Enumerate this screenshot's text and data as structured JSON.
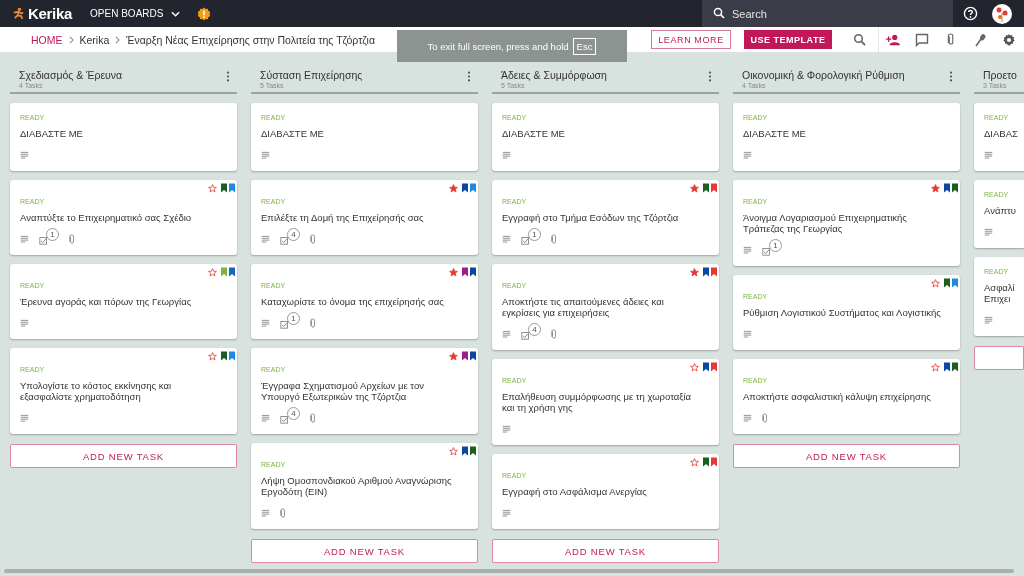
{
  "topbar": {
    "logo": "Kerika",
    "open_boards": "OPEN BOARDS",
    "search": {
      "placeholder": "Search"
    }
  },
  "breadcrumb": [
    "HOME",
    "Kerika",
    "Έναρξη Νέας Επιχείρησης στην Πολιτεία της Τζόρτζια"
  ],
  "buttons": {
    "learn_more": "LEARN MORE",
    "use_template": "USE TEMPLATE"
  },
  "fullscreen_notice": {
    "text": "To exit full screen, press and hold",
    "key": "Esc"
  },
  "columns": [
    {
      "title": "Σχεδιασμός & Έρευνα",
      "count": "4 Tasks",
      "add_label": "ADD NEW TASK",
      "cards": [
        {
          "status": "READY",
          "title": "ΔΙΑΒΑΣΤΕ ΜΕ"
        },
        {
          "status": "READY",
          "title": "Αναπτύξτε το Επιχειρηματικό σας Σχέδιο",
          "starred": false,
          "tags": [
            {
              "color": "#1b5e20"
            },
            {
              "color": "#1e88e5"
            }
          ],
          "checklist_count": "1",
          "attachment": true
        },
        {
          "status": "READY",
          "title": "Έρευνα αγοράς και πόρων της Γεωργίας",
          "starred": false,
          "tags": [
            {
              "color": "#7cb342"
            },
            {
              "color": "#1565c0"
            }
          ]
        },
        {
          "status": "READY",
          "title": "Υπολογίστε το κόστος εκκίνησης και εξασφαλίστε χρηματοδότηση",
          "starred": false,
          "tags": [
            {
              "color": "#1b5e20"
            },
            {
              "color": "#1e88e5"
            }
          ]
        }
      ]
    },
    {
      "title": "Σύσταση Επιχείρησης",
      "count": "5 Tasks",
      "add_label": "ADD NEW TASK",
      "cards": [
        {
          "status": "READY",
          "title": "ΔΙΑΒΑΣΤΕ ΜΕ"
        },
        {
          "status": "READY",
          "title": "Επιλέξτε τη Δομή της Επιχείρησής σας",
          "starred": true,
          "tags": [
            {
              "color": "#0d47a1"
            },
            {
              "color": "#1e88e5"
            }
          ],
          "checklist_count": "4",
          "attachment": true
        },
        {
          "status": "READY",
          "title": "Καταχωρίστε το όνομα της επιχείρησής σας",
          "starred": true,
          "tags": [
            {
              "color": "#9c1f8c"
            },
            {
              "color": "#0d47a1"
            }
          ],
          "checklist_count": "1",
          "attachment": true
        },
        {
          "status": "READY",
          "title": "Έγγραφα Σχηματισμού Αρχείων με τον Υπουργό Εξωτερικών της Τζόρτζια",
          "starred": true,
          "tags": [
            {
              "color": "#9c1f8c"
            },
            {
              "color": "#0d47a1"
            }
          ],
          "checklist_count": "4",
          "attachment": true
        },
        {
          "status": "READY",
          "title": "Λήψη Ομοσπονδιακού Αριθμού Αναγνώρισης Εργοδότη (EIN)",
          "starred": false,
          "tags": [
            {
              "color": "#0d47a1"
            },
            {
              "color": "#1b5e20"
            }
          ],
          "attachment": true
        }
      ]
    },
    {
      "title": "Άδειες & Συμμόρφωση",
      "count": "5 Tasks",
      "add_label": "ADD NEW TASK",
      "cards": [
        {
          "status": "READY",
          "title": "ΔΙΑΒΑΣΤΕ ΜΕ"
        },
        {
          "status": "READY",
          "title": "Εγγραφή στο Τμήμα Εσόδων της Τζόρτζια",
          "starred": true,
          "tags": [
            {
              "color": "#1b5e20"
            },
            {
              "color": "#e53935"
            }
          ],
          "checklist_count": "1",
          "attachment": true
        },
        {
          "status": "READY",
          "title": "Αποκτήστε τις απαιτούμενες άδειες και εγκρίσεις για επιχειρήσεις",
          "starred": true,
          "tags": [
            {
              "color": "#0d47a1"
            },
            {
              "color": "#e53935"
            }
          ],
          "checklist_count": "4",
          "attachment": true
        },
        {
          "status": "READY",
          "title": "Επαλήθευση συμμόρφωσης με τη χωροταξία και τη χρήση γης",
          "starred": false,
          "tags": [
            {
              "color": "#0d47a1"
            },
            {
              "color": "#e53935"
            }
          ]
        },
        {
          "status": "READY",
          "title": "Εγγραφή στο Ασφάλισμα Ανεργίας",
          "starred": false,
          "tags": [
            {
              "color": "#1b5e20"
            },
            {
              "color": "#e53935"
            }
          ]
        }
      ]
    },
    {
      "title": "Οικονομική & Φορολογική Ρύθμιση",
      "count": "4 Tasks",
      "add_label": "ADD NEW TASK",
      "cards": [
        {
          "status": "READY",
          "title": "ΔΙΑΒΑΣΤΕ ΜΕ"
        },
        {
          "status": "READY",
          "title": "Άνοιγμα Λογαριασμού Επιχειρηματικής Τράπεζας της Γεωργίας",
          "starred": true,
          "tags": [
            {
              "color": "#0d47a1"
            },
            {
              "color": "#1b5e20"
            }
          ],
          "checklist_count": "1"
        },
        {
          "status": "READY",
          "title": "Ρύθμιση Λογιστικού Συστήματος και Λογιστικής",
          "starred": false,
          "tags": [
            {
              "color": "#1b5e20"
            },
            {
              "color": "#1e88e5"
            }
          ]
        },
        {
          "status": "READY",
          "title": "Αποκτήστε ασφαλιστική κάλυψη επιχείρησης",
          "starred": false,
          "tags": [
            {
              "color": "#0d47a1"
            },
            {
              "color": "#1b5e20"
            }
          ],
          "attachment": true
        }
      ]
    },
    {
      "title": "Προετο",
      "count": "3 Tasks",
      "cards": [
        {
          "status": "READY",
          "title": "ΔΙΑΒΑΣ"
        },
        {
          "status": "READY",
          "title": "Ανάπτυ"
        },
        {
          "status": "READY",
          "title": "Ασφαλί Επιχει"
        }
      ]
    }
  ]
}
